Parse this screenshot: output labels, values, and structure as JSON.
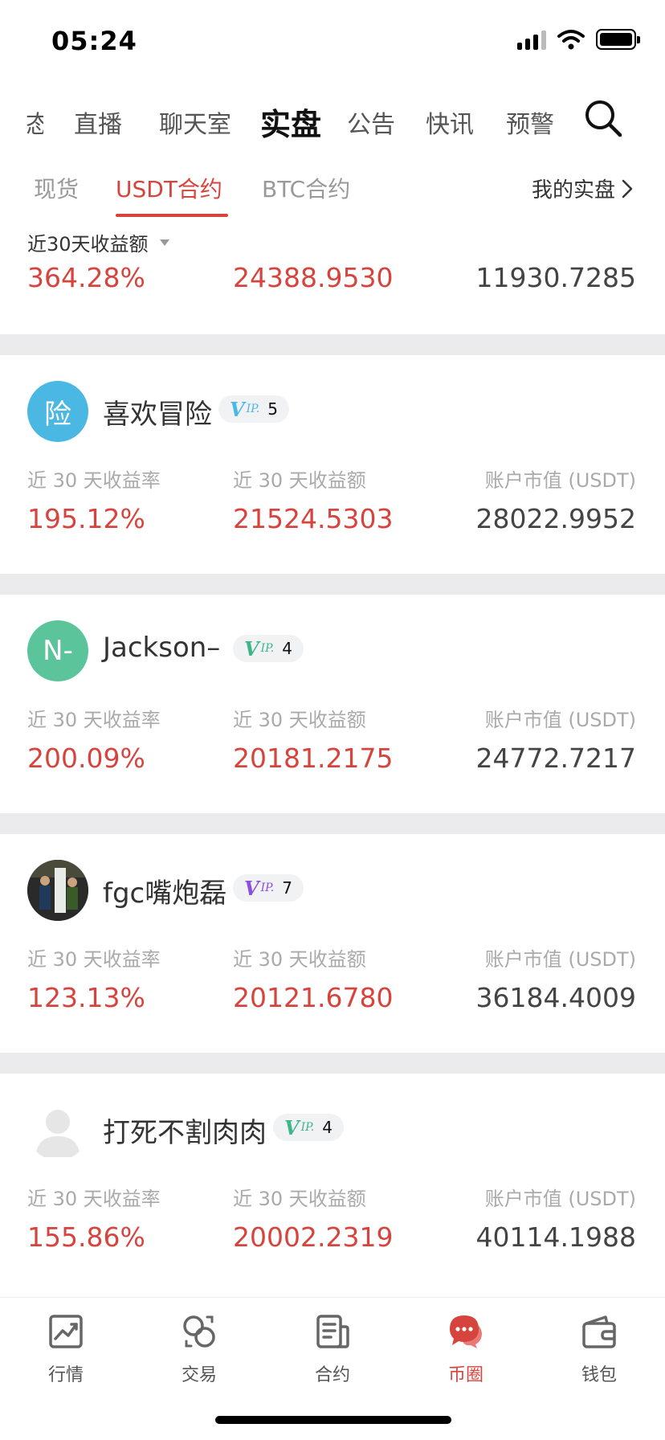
{
  "status": {
    "time": "05:24"
  },
  "top_nav": {
    "tabs": [
      {
        "label": "态"
      },
      {
        "label": "直播"
      },
      {
        "label": "聊天室"
      },
      {
        "label": "实盘",
        "active": true
      },
      {
        "label": "公告"
      },
      {
        "label": "快讯"
      },
      {
        "label": "预警"
      }
    ],
    "search_icon": "search-icon"
  },
  "sub_tabs": {
    "tabs": [
      {
        "label": "现货"
      },
      {
        "label": "USDT合约",
        "active": true
      },
      {
        "label": "BTC合约"
      }
    ],
    "my_real": "我的实盘"
  },
  "sort": {
    "label": "近30天收益额"
  },
  "partial_row": {
    "rate": "364.28%",
    "profit": "24388.9530",
    "value": "11930.7285"
  },
  "labels": {
    "rate": "近 30 天收益率",
    "profit": "近 30 天收益额",
    "value": "账户市值 (USDT)"
  },
  "traders": [
    {
      "avatar_text": "险",
      "avatar_color": "#4bb8e4",
      "name": "喜欢冒险",
      "vip": "5",
      "vip_color": "#4bb8e4",
      "rate": "195.12%",
      "profit": "21524.5303",
      "value": "28022.9952"
    },
    {
      "avatar_text": "N-",
      "avatar_color": "#5cc49a",
      "name": "Jackson–",
      "vip": "4",
      "vip_color": "#3fb58a",
      "rate": "200.09%",
      "profit": "20181.2175",
      "value": "24772.7217"
    },
    {
      "avatar_text": "",
      "avatar_color": "#3b3b3b",
      "name": "fgc嘴炮磊",
      "vip": "7",
      "vip_color": "#8a4fe0",
      "rate": "123.13%",
      "profit": "20121.6780",
      "value": "36184.4009"
    },
    {
      "avatar_text": "",
      "avatar_color": "#ffffff",
      "name": "打死不割肉肉",
      "vip": "4",
      "vip_color": "#3fb58a",
      "rate": "155.86%",
      "profit": "20002.2319",
      "value": "40114.1988"
    }
  ],
  "vip_text": {
    "v": "V",
    "ip": "IP."
  },
  "bottom_nav": [
    {
      "label": "行情",
      "icon": "chart-icon"
    },
    {
      "label": "交易",
      "icon": "exchange-icon"
    },
    {
      "label": "合约",
      "icon": "contract-icon"
    },
    {
      "label": "币圈",
      "icon": "chat-icon",
      "active": true
    },
    {
      "label": "钱包",
      "icon": "wallet-icon"
    }
  ],
  "colors": {
    "accent": "#d7443e",
    "divider": "#ebebed"
  }
}
